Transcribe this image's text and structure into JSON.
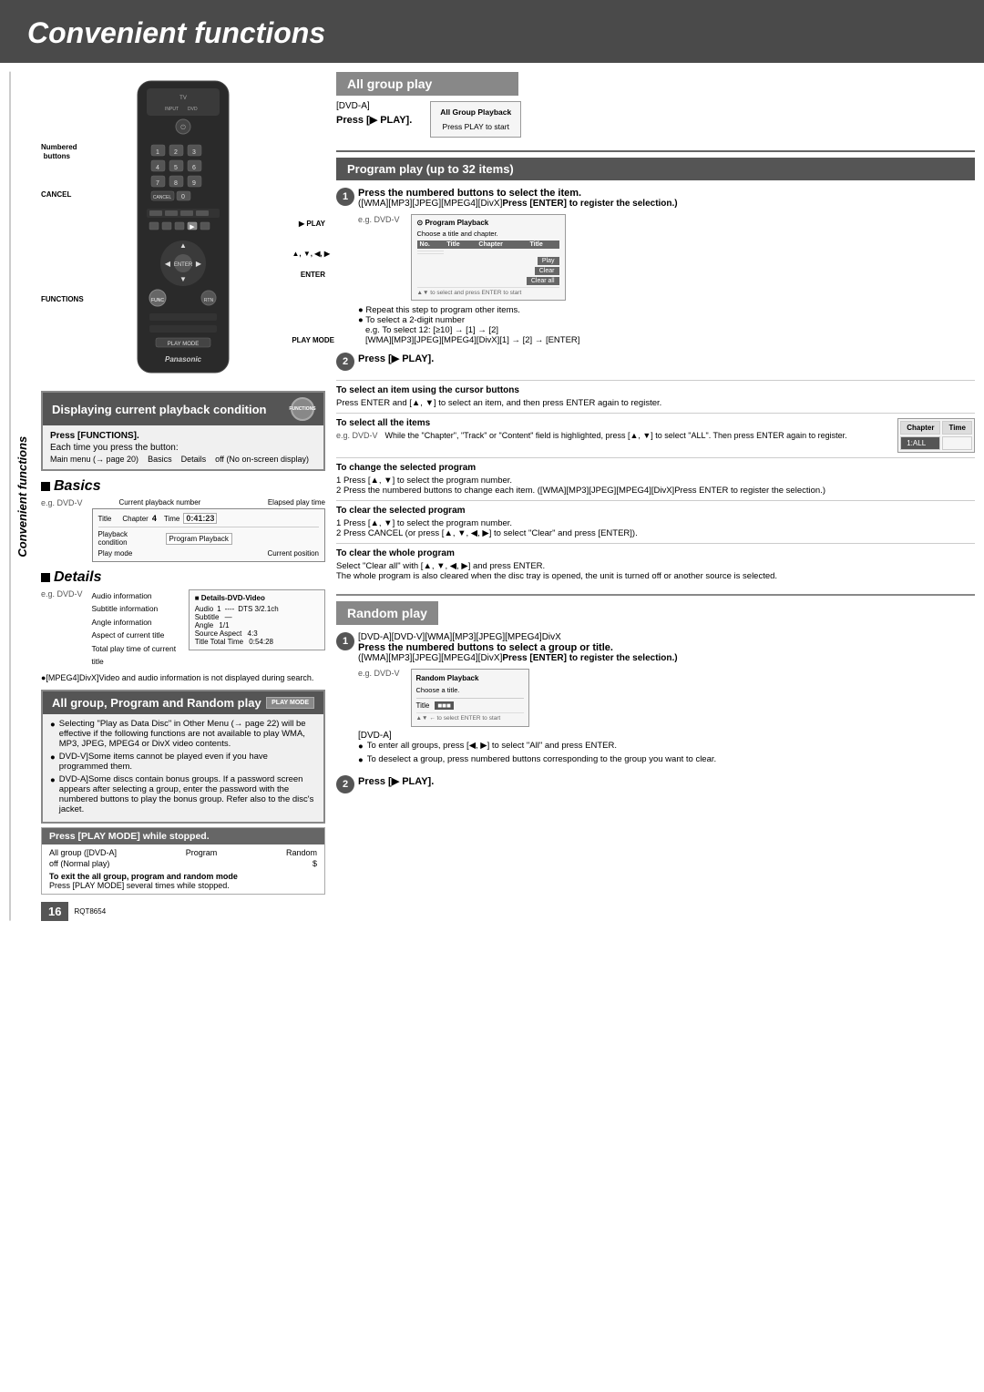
{
  "page": {
    "title": "Convenient functions",
    "pageNumber": "16",
    "docNumber": "RQT8654"
  },
  "header": {
    "title": "Convenient functions"
  },
  "sidebar_label": "Convenient functions",
  "remote": {
    "labels": {
      "numbered_buttons": "Numbered buttons",
      "cancel": "CANCEL",
      "functions": "FUNCTIONS",
      "play": "▶ PLAY",
      "arrows": "▲, ▼, ◀, ▶",
      "enter": "ENTER",
      "play_mode": "PLAY MODE",
      "panasonic": "Panasonic"
    }
  },
  "displaying_section": {
    "header": "Displaying current playback condition",
    "functions_label": "FUNCTIONS",
    "press_functions": "Press [FUNCTIONS].",
    "each_time": "Each time you press the button:",
    "states": [
      "Main menu (→ page 20)",
      "Basics",
      "Details",
      "off (No on-screen display)"
    ],
    "basics": {
      "title": "Basics",
      "eg_label": "e.g. DVD-V",
      "diagram": {
        "labels": [
          "Current playback number",
          "Elapsed play time"
        ],
        "title_label": "Title",
        "chapter_label": "Chapter",
        "chapter_value": "4",
        "time_label": "Time",
        "time_value": "0:41:23",
        "playback_label": "Playback condition",
        "program_playback": "Program Playback",
        "play_mode_label": "Play mode",
        "current_position_label": "Current position"
      }
    },
    "details": {
      "title": "Details",
      "eg_label": "e.g. DVD-V",
      "table_title": "■ Details-DVD-Video",
      "rows": [
        {
          "label": "Audio information",
          "field": "Audio",
          "num": "1",
          "value": "DTS 3/2.1ch"
        },
        {
          "label": "Subtitle information",
          "field": "Subtitle",
          "num": "—",
          "value": ""
        },
        {
          "label": "Angle information",
          "field": "Angle",
          "num": "1/1",
          "value": ""
        },
        {
          "label": "Aspect of current title",
          "field": "Source Aspect",
          "num": "4:3",
          "value": ""
        },
        {
          "label": "Total play time of current title",
          "field": "Title Total Time",
          "num": "0:54:28",
          "value": ""
        }
      ],
      "note": "●[MPEG4]DivX]Video and audio information is not displayed during search."
    }
  },
  "all_group_section": {
    "header": "All group, Program and Random play",
    "play_mode_label": "PLAY MODE",
    "bullets": [
      "Selecting \"Play as Data Disc\" in Other Menu (→ page 22) will be effective if the following functions are not available to play WMA, MP3, JPEG, MPEG4 or DivX video contents.",
      "DVD-V]Some items cannot be played even if you have programmed them.",
      "DVD-A]Some discs contain bonus groups. If a password screen appears after selecting a group, enter the password with the numbered buttons to play the bonus group. Refer also to the disc's jacket."
    ],
    "press_play_mode": {
      "header": "Press [PLAY MODE] while stopped.",
      "items": [
        "All group ([DVD-A]",
        "Program",
        "Random"
      ],
      "sub": "off (Normal play)",
      "dollar": "$"
    },
    "exit_note": {
      "title": "To exit the all group, program and random mode",
      "text": "Press [PLAY MODE] several times while stopped."
    }
  },
  "all_group_play": {
    "header": "All group play",
    "format_label": "[DVD-A]",
    "press_label": "Press [▶ PLAY].",
    "screen": {
      "title": "All Group Playback",
      "button": "Press PLAY to start"
    }
  },
  "program_play": {
    "header": "Program play (up to 32 items)",
    "step1": {
      "title": "Press the numbered buttons to select the item.",
      "formats": "([WMA][MP3][JPEG][MPEG4][DivX]",
      "press": "Press [ENTER] to register the selection.)",
      "eg_label": "e.g. DVD-V",
      "screen_title": "⊙ Program Playback",
      "screen_sub": "Choose a title and chapter.",
      "cols": [
        "No.",
        "Title",
        "Chapter",
        "Title"
      ],
      "btns": [
        "Play",
        "Clear",
        "Clear all"
      ],
      "note1": "● Repeat this step to program other items.",
      "note2": "● To select a 2-digit number",
      "note3": "e.g. To select 12: [≥10] → [1] → [2]",
      "note4": "[WMA][MP3][JPEG][MPEG4][DivX][1] → [2] → [ENTER]"
    },
    "step2": {
      "label": "Press [▶ PLAY]."
    },
    "select_item": {
      "title": "To select an item using the cursor buttons",
      "text": "Press ENTER and [▲, ▼] to select an item, and then press ENTER again to register."
    },
    "select_all": {
      "title": "To select all the items",
      "eg_label": "e.g. DVD-V",
      "text": "While the \"Chapter\", \"Track\" or \"Content\" field is highlighted, press [▲, ▼] to select \"ALL\". Then press ENTER again to register.",
      "table": {
        "headers": [
          "Chapter",
          "Time"
        ],
        "row": [
          "1:ALL",
          ""
        ]
      }
    },
    "change_program": {
      "title": "To change the selected program",
      "steps": [
        "Press [▲, ▼] to select the program number.",
        "Press the numbered buttons to change each item. ([WMA][MP3][JPEG][MPEG4][DivX]Press ENTER to register the selection.)"
      ]
    },
    "clear_program": {
      "title": "To clear the selected program",
      "steps": [
        "Press [▲, ▼] to select the program number.",
        "Press CANCEL (or press [▲, ▼, ◀, ▶] to select \"Clear\" and press [ENTER])."
      ]
    },
    "clear_whole": {
      "title": "To clear the whole program",
      "text1": "Select \"Clear all\" with [▲, ▼, ◀, ▶] and press ENTER.",
      "text2": "The whole program is also cleared when the disc tray is opened, the unit is turned off or another source is selected."
    }
  },
  "random_play": {
    "header": "Random play",
    "step1": {
      "formats": "[DVD-A][DVD-V][WMA][MP3][JPEG][MPEG4]DivX",
      "text": "Press the numbered buttons to select a group or title.",
      "formats2": "([WMA][MP3][JPEG][MPEG4][DivX]",
      "press": "Press [ENTER] to register the selection.)",
      "eg_label": "e.g. DVD-V",
      "screen": {
        "title": "Random Playback",
        "sub": "Choose a title.",
        "field": "Title",
        "value": "■■■"
      }
    },
    "dvd_a_label": "[DVD-A]",
    "notes": [
      "To enter all groups, press [◀, ▶] to select \"All\" and press ENTER.",
      "To deselect a group, press numbered buttons corresponding to the group you want to clear."
    ],
    "step2": {
      "label": "Press [▶ PLAY]."
    }
  }
}
